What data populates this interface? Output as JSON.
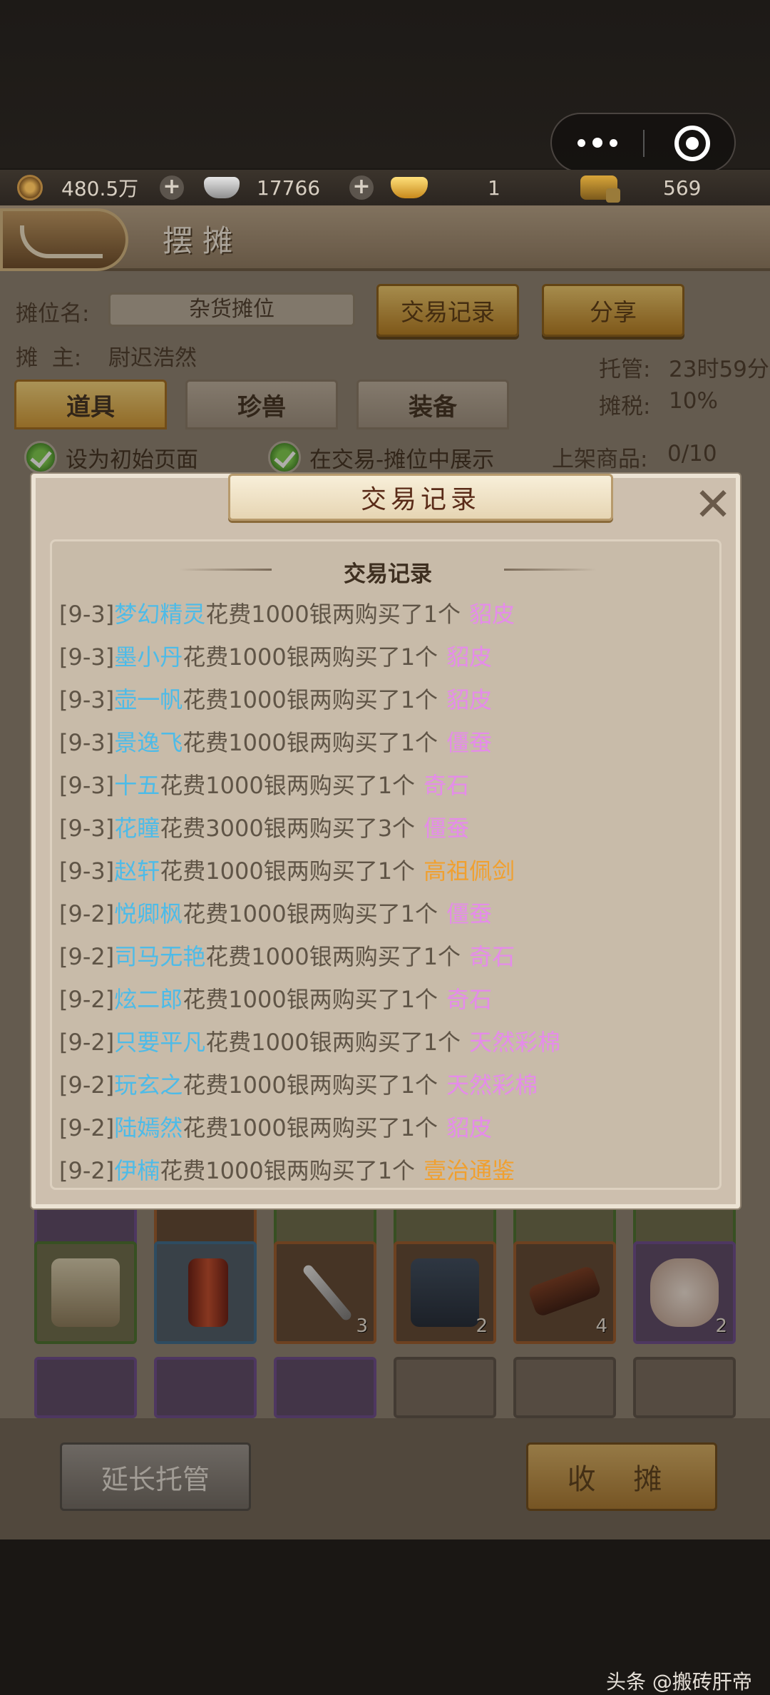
{
  "status_area": {},
  "resources": {
    "copper": "480.5万",
    "silver": "17766",
    "gold": "1",
    "bound_gold": "569"
  },
  "header": {
    "title": "摆摊"
  },
  "stall": {
    "name_label": "摊位名:",
    "name_value": "杂货摊位",
    "owner_label": "摊  主:",
    "owner_value": "尉迟浩然",
    "trade_record_btn": "交易记录",
    "share_btn": "分享",
    "hosting_label": "托管:",
    "hosting_value": "23时59分",
    "tax_label": "摊税:",
    "tax_value": "10%",
    "listed_label": "上架商品:",
    "listed_value": "0/10"
  },
  "tabs": [
    {
      "label": "道具",
      "active": true
    },
    {
      "label": "珍兽",
      "active": false
    },
    {
      "label": "装备",
      "active": false
    }
  ],
  "options": {
    "initial_page": "设为初始页面",
    "show_in_trade": "在交易-摊位中展示"
  },
  "grid": {
    "row1_counts": [
      "",
      "",
      "3",
      "2",
      "4",
      "2"
    ]
  },
  "bottom": {
    "extend_btn": "延长托管",
    "collect_btn": "收 摊"
  },
  "dialog": {
    "banner_title": "交易记录",
    "inner_title": "交易记录",
    "records": [
      {
        "date": "[9-3]",
        "buyer": "梦幻精灵",
        "text": "花费1000银两购买了1个",
        "item": "貂皮",
        "item_color": "#e58bea"
      },
      {
        "date": "[9-3]",
        "buyer": "墨小丹",
        "text": "花费1000银两购买了1个",
        "item": "貂皮",
        "item_color": "#e58bea"
      },
      {
        "date": "[9-3]",
        "buyer": "壶一帆",
        "text": "花费1000银两购买了1个",
        "item": "貂皮",
        "item_color": "#e58bea"
      },
      {
        "date": "[9-3]",
        "buyer": "景逸飞",
        "text": "花费1000银两购买了1个",
        "item": "僵蚕",
        "item_color": "#e58bea"
      },
      {
        "date": "[9-3]",
        "buyer": "十五",
        "text": "花费1000银两购买了1个",
        "item": "奇石",
        "item_color": "#e58bea"
      },
      {
        "date": "[9-3]",
        "buyer": "花瞳",
        "text": "花费3000银两购买了3个",
        "item": "僵蚕",
        "item_color": "#e58bea"
      },
      {
        "date": "[9-3]",
        "buyer": "赵轩",
        "text": "花费1000银两购买了1个",
        "item": "高祖佩剑",
        "item_color": "#f0a030"
      },
      {
        "date": "[9-2]",
        "buyer": "悦卿枫",
        "text": "花费1000银两购买了1个",
        "item": "僵蚕",
        "item_color": "#e58bea"
      },
      {
        "date": "[9-2]",
        "buyer": "司马无艳",
        "text": "花费1000银两购买了1个",
        "item": "奇石",
        "item_color": "#e58bea"
      },
      {
        "date": "[9-2]",
        "buyer": "炫二郎",
        "text": "花费1000银两购买了1个",
        "item": "奇石",
        "item_color": "#e58bea"
      },
      {
        "date": "[9-2]",
        "buyer": "只要平凡",
        "text": "花费1000银两购买了1个",
        "item": "天然彩棉",
        "item_color": "#e58bea"
      },
      {
        "date": "[9-2]",
        "buyer": "玩玄之",
        "text": "花费1000银两购买了1个",
        "item": "天然彩棉",
        "item_color": "#e58bea"
      },
      {
        "date": "[9-2]",
        "buyer": "陆嫣然",
        "text": "花费1000银两购买了1个",
        "item": "貂皮",
        "item_color": "#e58bea"
      },
      {
        "date": "[9-2]",
        "buyer": "伊楠",
        "text": "花费1000银两购买了1个",
        "item": "壹治通鉴",
        "item_color": "#f0a030"
      }
    ]
  },
  "watermark": "头条 @搬砖肝帝"
}
